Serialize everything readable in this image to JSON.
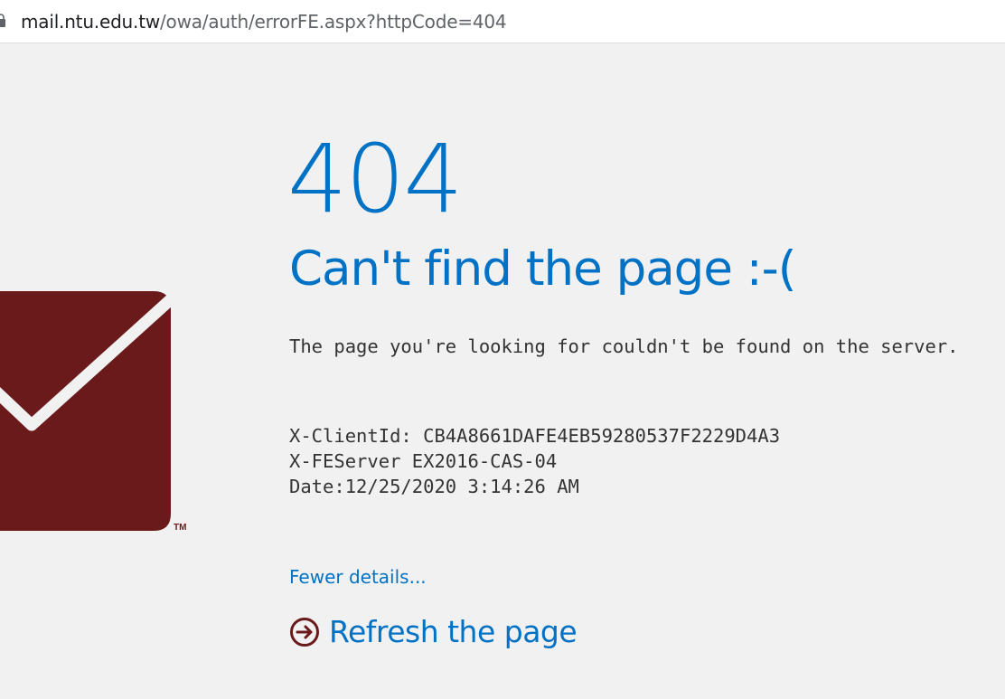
{
  "browser": {
    "url_host": "mail.ntu.edu.tw",
    "url_path": "/owa/auth/errorFE.aspx?httpCode=404"
  },
  "logo": {
    "icon": "envelope-icon",
    "trademark": "TM",
    "color": "#6b1a1b"
  },
  "error": {
    "code": "404",
    "title": "Can't find the page :-(",
    "message": "The page you're looking for couldn't be found on the server."
  },
  "details": {
    "client_id": "X-ClientId: CB4A8661DAFE4EB59280537F2229D4A3",
    "fe_server": "X-FEServer EX2016-CAS-04",
    "date": "Date:12/25/2020 3:14:26 AM"
  },
  "links": {
    "fewer_details": "Fewer details...",
    "refresh": "Refresh the page",
    "refresh_icon": "circle-arrow-right-icon"
  },
  "colors": {
    "accent": "#0072c6",
    "text": "#333333",
    "background": "#f1f1f1",
    "brand": "#6b1a1b"
  }
}
